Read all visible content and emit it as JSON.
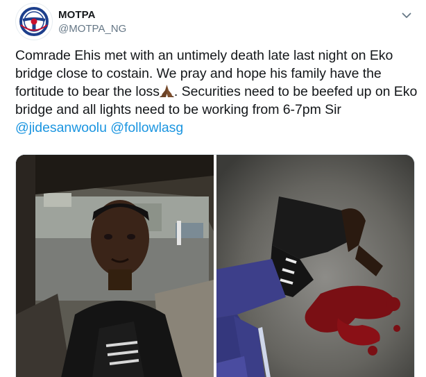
{
  "author": {
    "name": "MOTPA",
    "handle": "@MOTPA_NG"
  },
  "tweet": {
    "text_part1": "Comrade Ehis met with an untimely death late last night on Eko bridge close to costain. We pray and hope his family have the fortitude to bear the loss",
    "emoji": "praying-hands-emoji",
    "text_part2": ". Securities need to be beefed up on Eko bridge and all lights need to be working from 6-7pm Sir ",
    "mention1": "@jidesanwoolu",
    "mention2": "@followlasg"
  },
  "media": {
    "photos": [
      {
        "icon": "selfie-photo"
      },
      {
        "icon": "victim-photo"
      }
    ]
  },
  "colors": {
    "link": "#1b95e0",
    "secondary_text": "#657786",
    "text": "#14171a"
  }
}
